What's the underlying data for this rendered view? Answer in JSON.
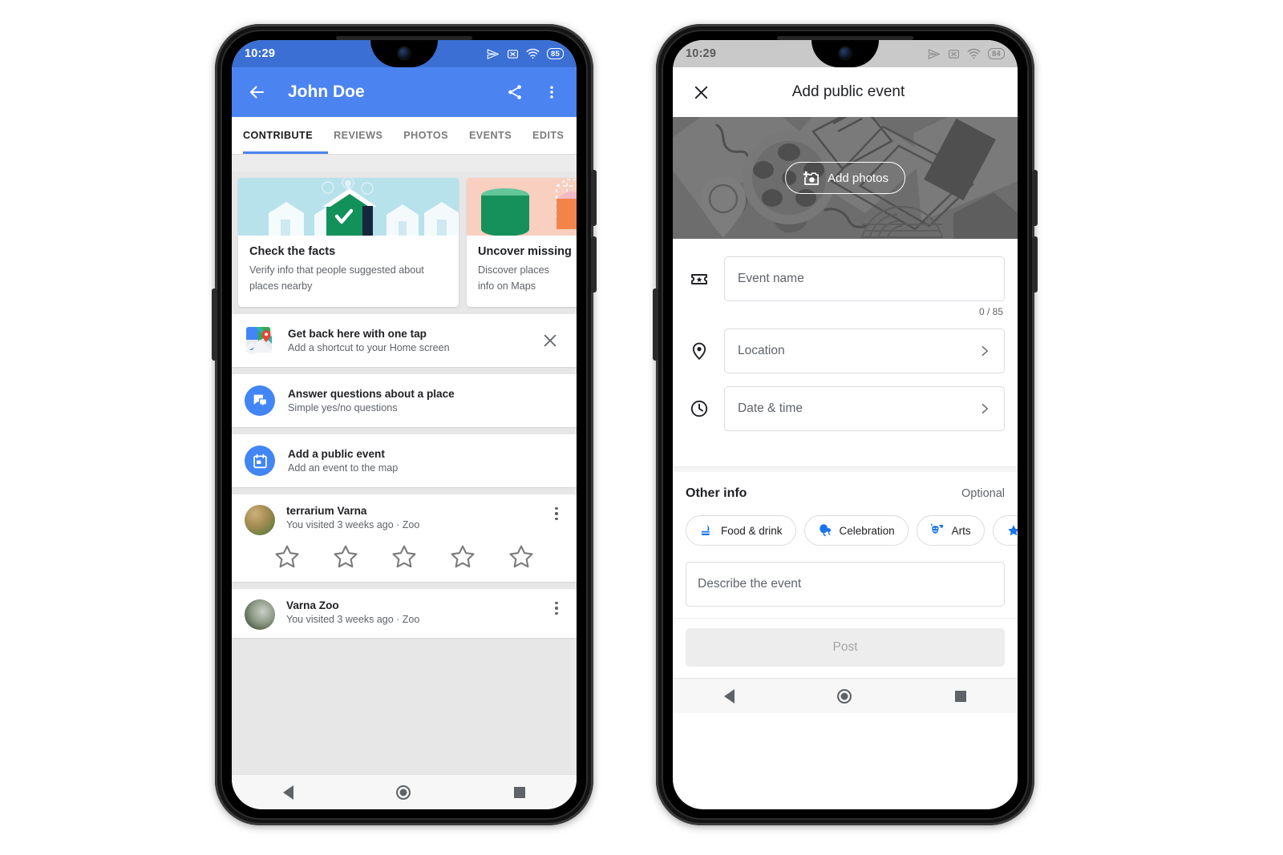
{
  "theme": {
    "blue_appbar": "#4b84f0",
    "statusbar_blue": "#3b6fd4",
    "google_blue": "#4285f4",
    "grey_statusbar": "#c9c9c9",
    "photo_banner": "#6d6d6d"
  },
  "left_phone": {
    "status_bar": {
      "time": "10:29",
      "battery": "85"
    },
    "app_bar": {
      "title": "John Doe",
      "back_icon": "back-arrow-icon",
      "share_icon": "share-icon",
      "overflow_icon": "more-vert-icon"
    },
    "tabs": [
      {
        "label": "CONTRIBUTE",
        "active": true
      },
      {
        "label": "REVIEWS",
        "active": false
      },
      {
        "label": "PHOTOS",
        "active": false
      },
      {
        "label": "EVENTS",
        "active": false
      },
      {
        "label": "EDITS",
        "active": false
      }
    ],
    "cards": [
      {
        "title": "Check the facts",
        "subtitle": "Verify info that people suggested about places nearby"
      },
      {
        "title": "Uncover missing",
        "subtitle": "Discover places\ninfo on Maps"
      }
    ],
    "shortcut_row": {
      "title": "Get back here with one tap",
      "subtitle": "Add a shortcut to your Home screen",
      "close_icon": "close-icon"
    },
    "action_rows": [
      {
        "title": "Answer questions about a place",
        "subtitle": "Simple yes/no questions",
        "icon": "question-answer-icon"
      },
      {
        "title": "Add a public event",
        "subtitle": "Add an event to the map",
        "icon": "event-calendar-icon"
      }
    ],
    "reviews": [
      {
        "name": "terrarium Varna",
        "meta": "You visited 3 weeks ago · Zoo",
        "stars": 5,
        "filled": 0
      },
      {
        "name": "Varna Zoo",
        "meta": "You visited 3 weeks ago · Zoo",
        "stars": 5,
        "filled": 0
      }
    ],
    "nav_bar": {
      "back": "nav-back-icon",
      "home": "nav-home-icon",
      "recents": "nav-recents-icon"
    }
  },
  "right_phone": {
    "status_bar": {
      "time": "10:29",
      "battery": "84"
    },
    "app_bar": {
      "title": "Add public event",
      "close_icon": "close-icon"
    },
    "photo_banner": {
      "button_label": "Add photos",
      "camera_icon": "add-photo-icon"
    },
    "fields": [
      {
        "label": "Event name",
        "icon": "ticket-icon",
        "chevron": false
      },
      {
        "label": "Location",
        "icon": "location-pin-icon",
        "chevron": true
      },
      {
        "label": "Date & time",
        "icon": "clock-icon",
        "chevron": true
      }
    ],
    "char_counter": "0 / 85",
    "other_info": {
      "heading": "Other info",
      "optional": "Optional"
    },
    "chips": [
      {
        "label": "Food & drink",
        "icon": "food-drink-icon"
      },
      {
        "label": "Celebration",
        "icon": "balloon-icon"
      },
      {
        "label": "Arts",
        "icon": "theatre-masks-icon"
      },
      {
        "label": "",
        "icon": "partial-chip-icon"
      }
    ],
    "description_placeholder": "Describe the event",
    "post_button": "Post",
    "nav_bar": {
      "back": "nav-back-icon",
      "home": "nav-home-icon",
      "recents": "nav-recents-icon"
    }
  }
}
